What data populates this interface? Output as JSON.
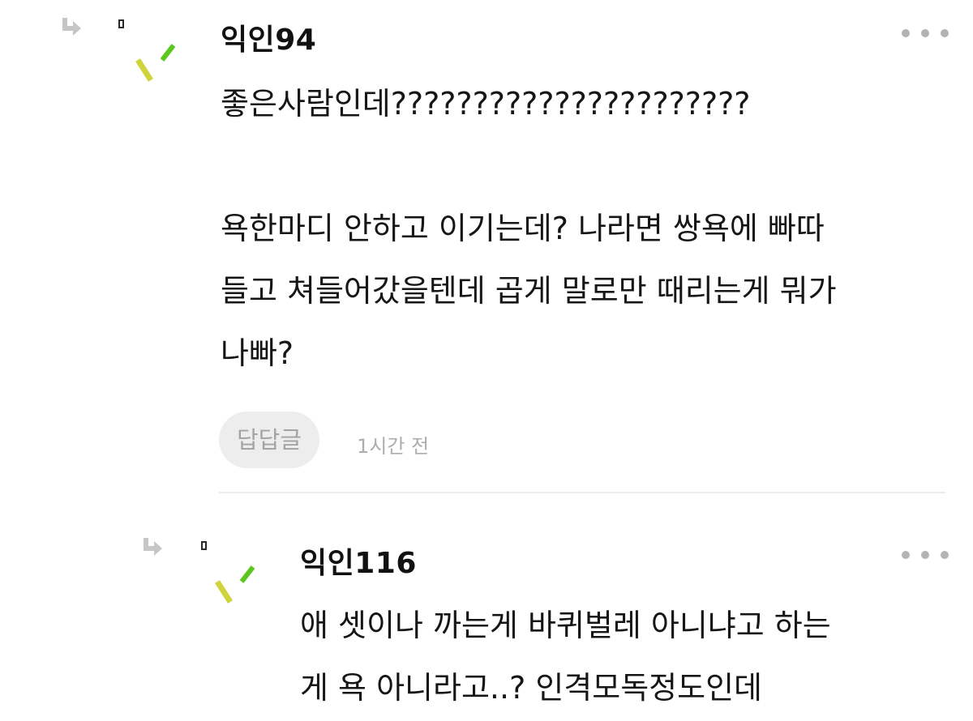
{
  "comments": [
    {
      "nickname": "익인94",
      "lines": [
        "좋은사람인데??????????????????????",
        "",
        "욕한마디 안하고 이기는데? 나라면 쌍욕에 빠따",
        "들고 쳐들어갔을텐데 곱게 말로만 때리는게 뭐가",
        "나빠?"
      ],
      "reply_label": "답답글",
      "time": "1시간 전"
    },
    {
      "nickname": "익인116",
      "lines": [
        "애 셋이나 까는게 바퀴벌레 아니냐고 하는",
        "게 욕 아니라고..? 인격모독정도인데"
      ]
    }
  ],
  "icons": {
    "reply_arrow": "reply-arrow-icon",
    "more": "more-options-icon",
    "avatar": "avatar-icon",
    "broken_image": "broken-image-icon"
  },
  "colors": {
    "avatar_yellow": "#cfd43a",
    "avatar_green": "#5cc61d",
    "chip_bg": "#ededed",
    "muted_text": "#adadad"
  }
}
